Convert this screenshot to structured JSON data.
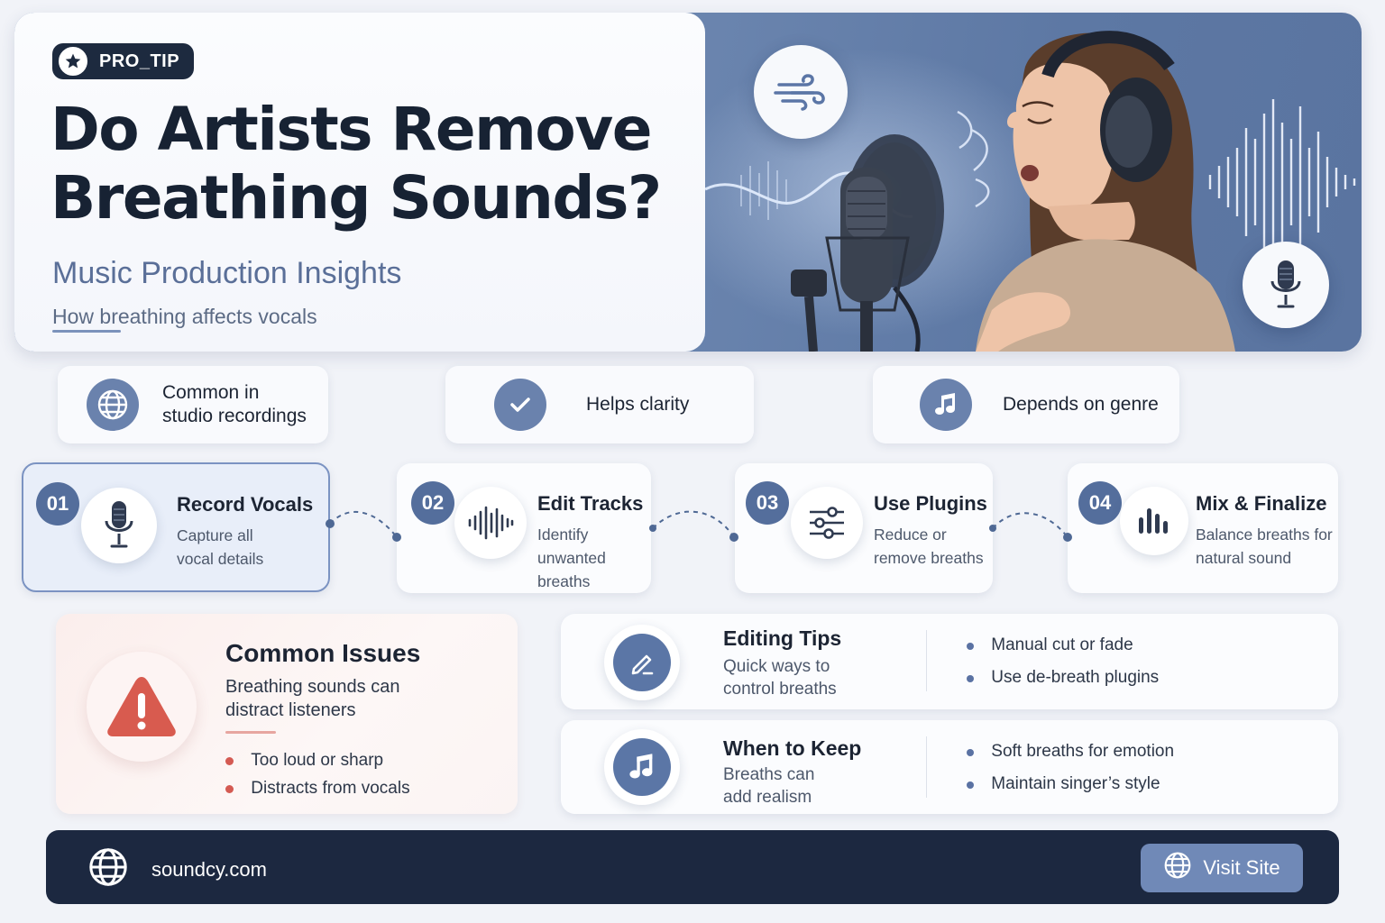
{
  "hero": {
    "badge": "PRO_TIP",
    "title_line1": "Do Artists Remove",
    "title_line2": "Breathing Sounds?",
    "subtitle": "Music Production Insights",
    "tagline": "How breathing affects vocals",
    "icons": [
      "wind-icon",
      "microphone-icon"
    ]
  },
  "features": [
    {
      "icon": "globe-icon",
      "line1": "Common in",
      "line2": "studio recordings"
    },
    {
      "icon": "check-icon",
      "label": "Helps clarity"
    },
    {
      "icon": "music-note-icon",
      "label": "Depends on genre"
    }
  ],
  "steps": [
    {
      "num": "01",
      "icon": "microphone-icon",
      "title": "Record Vocals",
      "desc1": "Capture all",
      "desc2": "vocal details"
    },
    {
      "num": "02",
      "icon": "waveform-icon",
      "title": "Edit Tracks",
      "desc1": "Identify",
      "desc2": "unwanted breaths"
    },
    {
      "num": "03",
      "icon": "sliders-icon",
      "title": "Use Plugins",
      "desc1": "Reduce or",
      "desc2": "remove breaths"
    },
    {
      "num": "04",
      "icon": "equalizer-icon",
      "title": "Mix & Finalize",
      "desc1": "Balance breaths for",
      "desc2": "natural sound"
    }
  ],
  "issues": {
    "icon": "warning-icon",
    "title": "Common Issues",
    "desc1": "Breathing sounds can",
    "desc2": "distract listeners",
    "bullets": [
      "Too loud or sharp",
      "Distracts from vocals"
    ]
  },
  "editing": {
    "icon": "pencil-icon",
    "title": "Editing Tips",
    "desc1": "Quick ways to",
    "desc2": "control breaths",
    "bullets": [
      "Manual cut or fade",
      "Use de-breath plugins"
    ]
  },
  "keep": {
    "icon": "music-note-icon",
    "title": "When to Keep",
    "desc1": "Breaths can",
    "desc2": "add realism",
    "bullets": [
      "Soft breaths for emotion",
      "Maintain singer’s style"
    ]
  },
  "footer": {
    "site": "soundcy.com",
    "button": "Visit Site"
  },
  "colors": {
    "accent": "#5b76a6",
    "navy": "#1c2840",
    "warning": "#d45a52"
  }
}
